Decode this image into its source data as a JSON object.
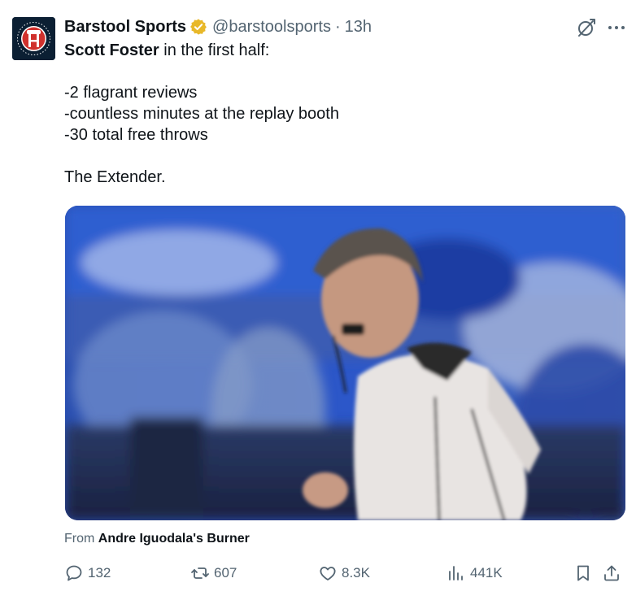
{
  "tweet": {
    "display_name": "Barstool Sports",
    "handle": "@barstoolsports",
    "separator": "·",
    "time": "13h",
    "mention": "Scott Foster",
    "line1_rest": " in the first half:",
    "lines": [
      "-2 flagrant reviews",
      "-countless minutes at the replay booth",
      "-30 total free throws"
    ],
    "closing": "The Extender."
  },
  "source": {
    "prefix": "From ",
    "name": "Andre Iguodala's Burner"
  },
  "actions": {
    "replies": "132",
    "retweets": "607",
    "likes": "8.3K",
    "views": "441K"
  },
  "colors": {
    "text": "#0f1419",
    "muted": "#536471",
    "verified": "#e8b829",
    "avatar_bg": "#0b1f33",
    "avatar_accent": "#d0312d"
  },
  "icons": {
    "verified": "verified-badge-icon",
    "grok": "grok-icon",
    "more": "more-icon",
    "reply": "reply-icon",
    "retweet": "retweet-icon",
    "like": "heart-icon",
    "views": "views-icon",
    "bookmark": "bookmark-icon",
    "share": "share-icon"
  }
}
